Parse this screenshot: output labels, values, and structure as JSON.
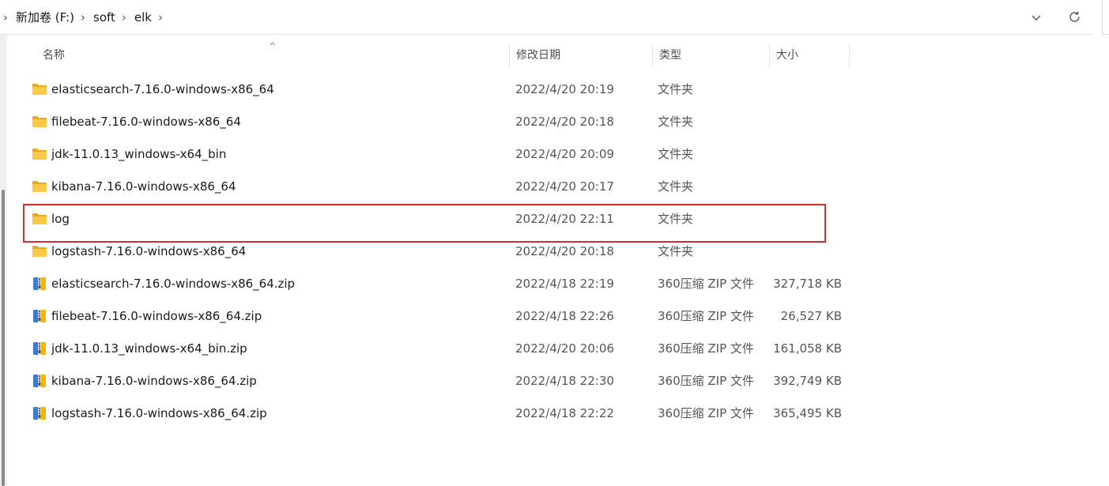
{
  "breadcrumb": [
    "新加卷 (F:)",
    "soft",
    "elk"
  ],
  "icons": {
    "folder": "folder-icon",
    "zip": "zip-archive-icon",
    "chevron": "chevron-right-icon",
    "dropdown": "chevron-down-icon",
    "refresh": "refresh-icon",
    "sort": "sort-ascending-icon"
  },
  "columns": {
    "name": "名称",
    "date": "修改日期",
    "type": "类型",
    "size": "大小"
  },
  "files": [
    {
      "name": "elasticsearch-7.16.0-windows-x86_64",
      "date": "2022/4/20 20:19",
      "type": "文件夹",
      "size": "",
      "kind": "folder"
    },
    {
      "name": "filebeat-7.16.0-windows-x86_64",
      "date": "2022/4/20 20:18",
      "type": "文件夹",
      "size": "",
      "kind": "folder"
    },
    {
      "name": "jdk-11.0.13_windows-x64_bin",
      "date": "2022/4/20 20:09",
      "type": "文件夹",
      "size": "",
      "kind": "folder"
    },
    {
      "name": "kibana-7.16.0-windows-x86_64",
      "date": "2022/4/20 20:17",
      "type": "文件夹",
      "size": "",
      "kind": "folder"
    },
    {
      "name": "log",
      "date": "2022/4/20 22:11",
      "type": "文件夹",
      "size": "",
      "kind": "folder",
      "highlighted": true
    },
    {
      "name": "logstash-7.16.0-windows-x86_64",
      "date": "2022/4/20 20:18",
      "type": "文件夹",
      "size": "",
      "kind": "folder"
    },
    {
      "name": "elasticsearch-7.16.0-windows-x86_64.zip",
      "date": "2022/4/18 22:19",
      "type": "360压缩 ZIP 文件",
      "size": "327,718 KB",
      "kind": "zip"
    },
    {
      "name": "filebeat-7.16.0-windows-x86_64.zip",
      "date": "2022/4/18 22:26",
      "type": "360压缩 ZIP 文件",
      "size": "26,527 KB",
      "kind": "zip"
    },
    {
      "name": "jdk-11.0.13_windows-x64_bin.zip",
      "date": "2022/4/20 20:06",
      "type": "360压缩 ZIP 文件",
      "size": "161,058 KB",
      "kind": "zip"
    },
    {
      "name": "kibana-7.16.0-windows-x86_64.zip",
      "date": "2022/4/18 22:30",
      "type": "360压缩 ZIP 文件",
      "size": "392,749 KB",
      "kind": "zip"
    },
    {
      "name": "logstash-7.16.0-windows-x86_64.zip",
      "date": "2022/4/18 22:22",
      "type": "360压缩 ZIP 文件",
      "size": "365,495 KB",
      "kind": "zip"
    }
  ],
  "colors": {
    "highlight": "#d32f2f",
    "folder": "#f6c443",
    "zip_blue": "#3a7bd5"
  }
}
